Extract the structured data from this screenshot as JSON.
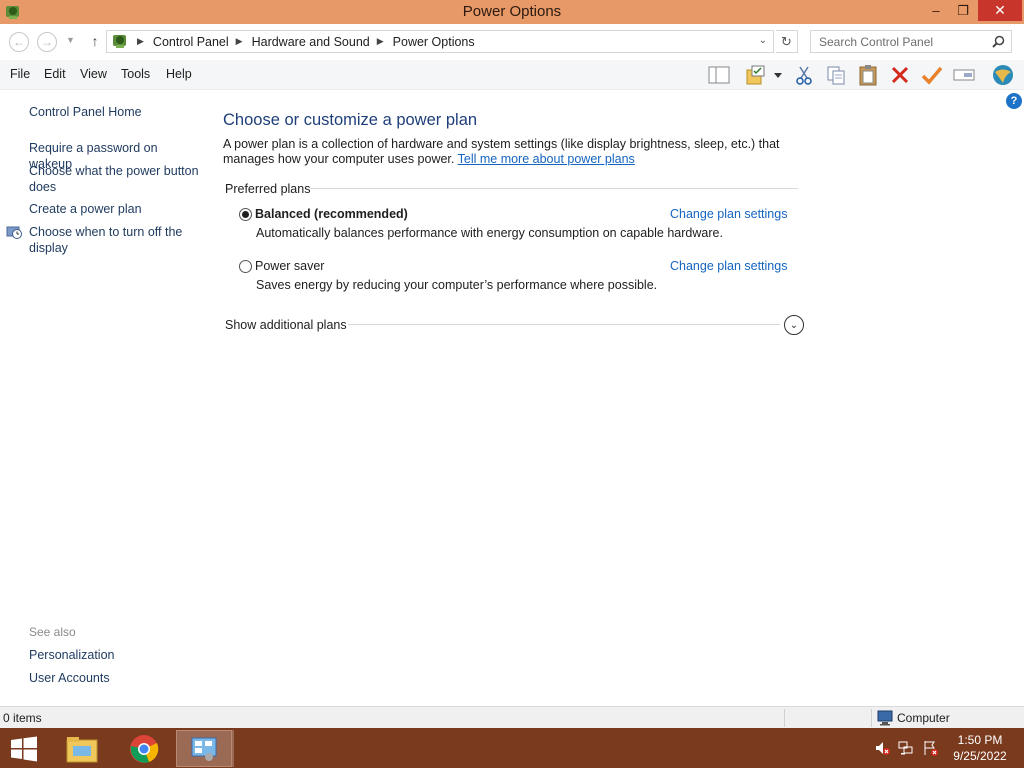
{
  "window": {
    "title": "Power Options",
    "controls": {
      "minimize": "–",
      "maximize": "❐",
      "close": "✕"
    }
  },
  "address_bar": {
    "breadcrumbs": [
      "Control Panel",
      "Hardware and Sound",
      "Power Options"
    ],
    "search_placeholder": "Search Control Panel"
  },
  "menu": [
    "File",
    "Edit",
    "View",
    "Tools",
    "Help"
  ],
  "toolbar_icons": [
    "layout-icon",
    "folder-options-icon",
    "dropdown-icon",
    "cut-icon",
    "copy-icon",
    "paste-icon",
    "delete-icon",
    "check-icon",
    "rename-icon",
    "globe-icon"
  ],
  "sidebar": {
    "home": "Control Panel Home",
    "links": [
      "Require a password on wakeup",
      "Choose what the power button does",
      "Create a power plan",
      "Choose when to turn off the display"
    ],
    "see_also_label": "See also",
    "see_also": [
      "Personalization",
      "User Accounts"
    ]
  },
  "main": {
    "heading": "Choose or customize a power plan",
    "description": "A power plan is a collection of hardware and system settings (like display brightness, sleep, etc.) that manages how your computer uses power.",
    "learn_more": "Tell me more about power plans",
    "preferred_label": "Preferred plans",
    "plans": [
      {
        "name": "Balanced (recommended)",
        "selected": true,
        "description": "Automatically balances performance with energy consumption on capable hardware.",
        "link": "Change plan settings"
      },
      {
        "name": "Power saver",
        "selected": false,
        "description": "Saves energy by reducing your computer’s performance where possible.",
        "link": "Change plan settings"
      }
    ],
    "additional_label": "Show additional plans",
    "help": "?"
  },
  "statusbar": {
    "items": "0 items",
    "location": "Computer"
  },
  "taskbar": {
    "time": "1:50 PM",
    "date": "9/25/2022"
  },
  "colors": {
    "titlebar": "#e89968",
    "taskbar": "#7a3a1e",
    "link": "#1565c0",
    "heading": "#1f3f7a"
  }
}
